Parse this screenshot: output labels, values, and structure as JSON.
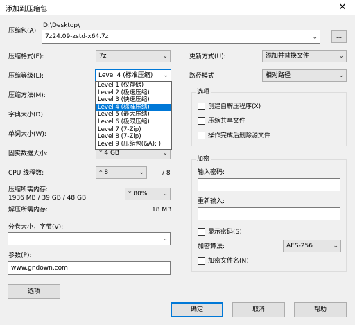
{
  "window": {
    "title": "添加到压缩包",
    "close_glyph": "✕"
  },
  "archive": {
    "label": "压缩包(A)",
    "path": "D:\\Desktop\\",
    "filename": "7z24.09-zstd-x64.7z",
    "browse_label": "..."
  },
  "format": {
    "label": "压缩格式(F):",
    "value": "7z"
  },
  "level": {
    "label": "压缩等级(L):",
    "value": "Level 4 (标准压缩)",
    "options": [
      "Level 1 (仅存储)",
      "Level 2 (极速压缩)",
      "Level 3 (快速压缩)",
      "Level 4 (标准压缩)",
      "Level 5 (最大压缩)",
      "Level 6 (极限压缩)",
      "Level 7 (7-Zip)",
      "Level 8 (7-Zip)",
      "Level 9 (压缩包(&A):  )"
    ],
    "selected_index": 3
  },
  "method": {
    "label": "压缩方法(M):"
  },
  "dict": {
    "label": "字典大小(D):"
  },
  "word": {
    "label": "单词大小(W):"
  },
  "solid": {
    "label": "固实数据大小:",
    "value": "* 4 GB"
  },
  "cpu": {
    "label": "CPU 线程数:",
    "value": "* 8",
    "max": "/ 8"
  },
  "memory": {
    "label": "压缩所需内存:",
    "detail": "1936 MB / 39 GB / 48 GB",
    "percent": "* 80%",
    "decomp_label": "解压所需内存:",
    "decomp_value": "18 MB"
  },
  "split": {
    "label": "分卷大小，字节(V):",
    "value": ""
  },
  "params": {
    "label": "参数(P):",
    "value": "www.gndown.com"
  },
  "options_button": "选项",
  "update": {
    "label": "更新方式(U):",
    "value": "添加并替换文件"
  },
  "pathmode": {
    "label": "路径模式",
    "value": "相对路径"
  },
  "options_group": {
    "title": "选项",
    "sfx": "创建自解压程序(X)",
    "shared": "压缩共享文件",
    "delete_after": "操作完成后删除源文件"
  },
  "encryption": {
    "title": "加密",
    "password_label": "输入密码:",
    "reenter_label": "重新输入:",
    "show_password": "显示密码(S)",
    "method_label": "加密算法:",
    "method_value": "AES-256",
    "encrypt_names": "加密文件名(N)"
  },
  "buttons": {
    "ok": "确定",
    "cancel": "取消",
    "help": "帮助"
  }
}
